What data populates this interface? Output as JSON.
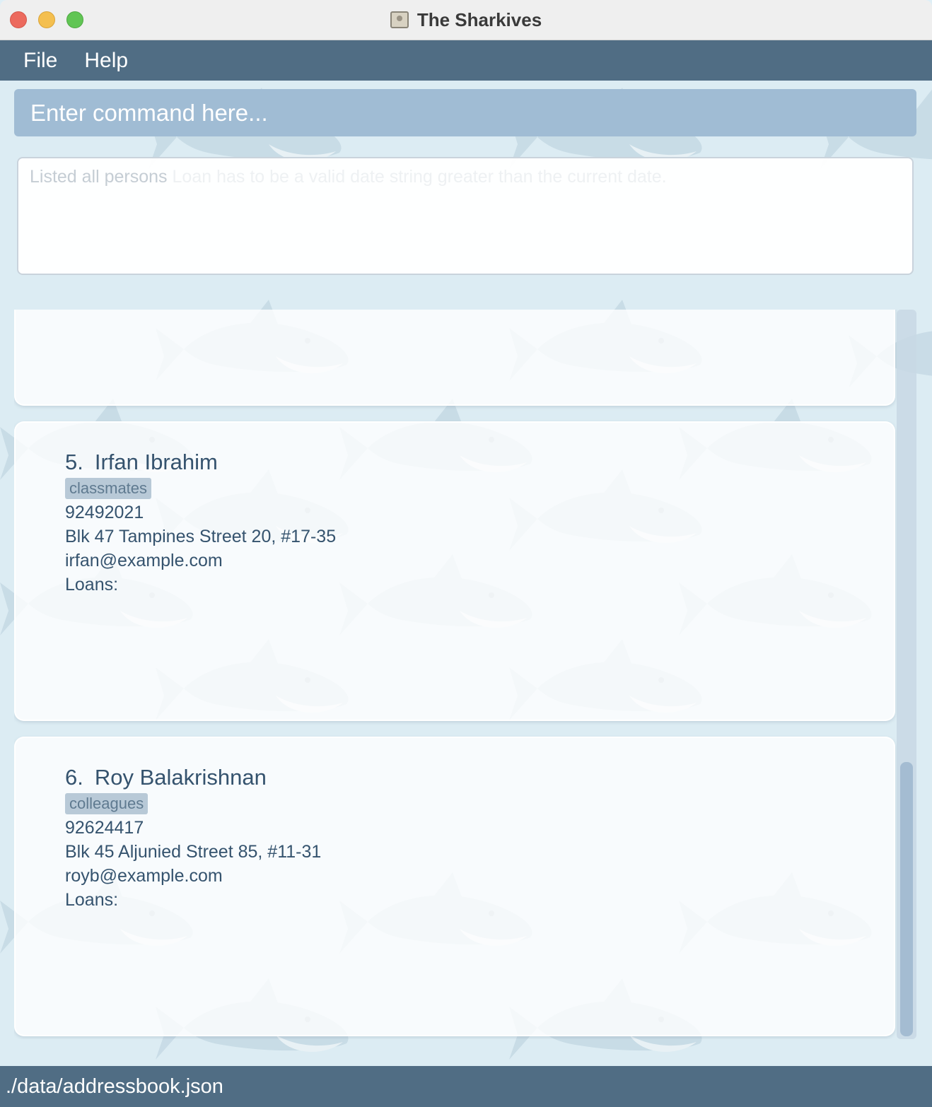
{
  "window": {
    "title": "The Sharkives"
  },
  "menu": {
    "items": [
      {
        "label": "File"
      },
      {
        "label": "Help"
      }
    ]
  },
  "command": {
    "placeholder": "Enter command here..."
  },
  "result": {
    "message": "Listed all persons",
    "faded_message": "Loan has to be a valid date string greater than the current date."
  },
  "persons": [
    {
      "index": "5.",
      "name": "Irfan Ibrahim",
      "tag": "classmates",
      "phone": "92492021",
      "address": "Blk 47 Tampines Street 20, #17-35",
      "email": "irfan@example.com",
      "loans_label": "Loans:"
    },
    {
      "index": "6.",
      "name": "Roy Balakrishnan",
      "tag": "colleagues",
      "phone": "92624417",
      "address": "Blk 45 Aljunied Street 85, #11-31",
      "email": "royb@example.com",
      "loans_label": "Loans:"
    }
  ],
  "status": {
    "file_path": "./data/addressbook.json"
  },
  "colors": {
    "menu_bar": "#506d84",
    "command_box": "#a0bcd4",
    "accent_text": "#35536e",
    "tag_bg": "#b8c9d7"
  },
  "icons": {
    "title": "address-book-icon",
    "background": "shark-pattern"
  }
}
